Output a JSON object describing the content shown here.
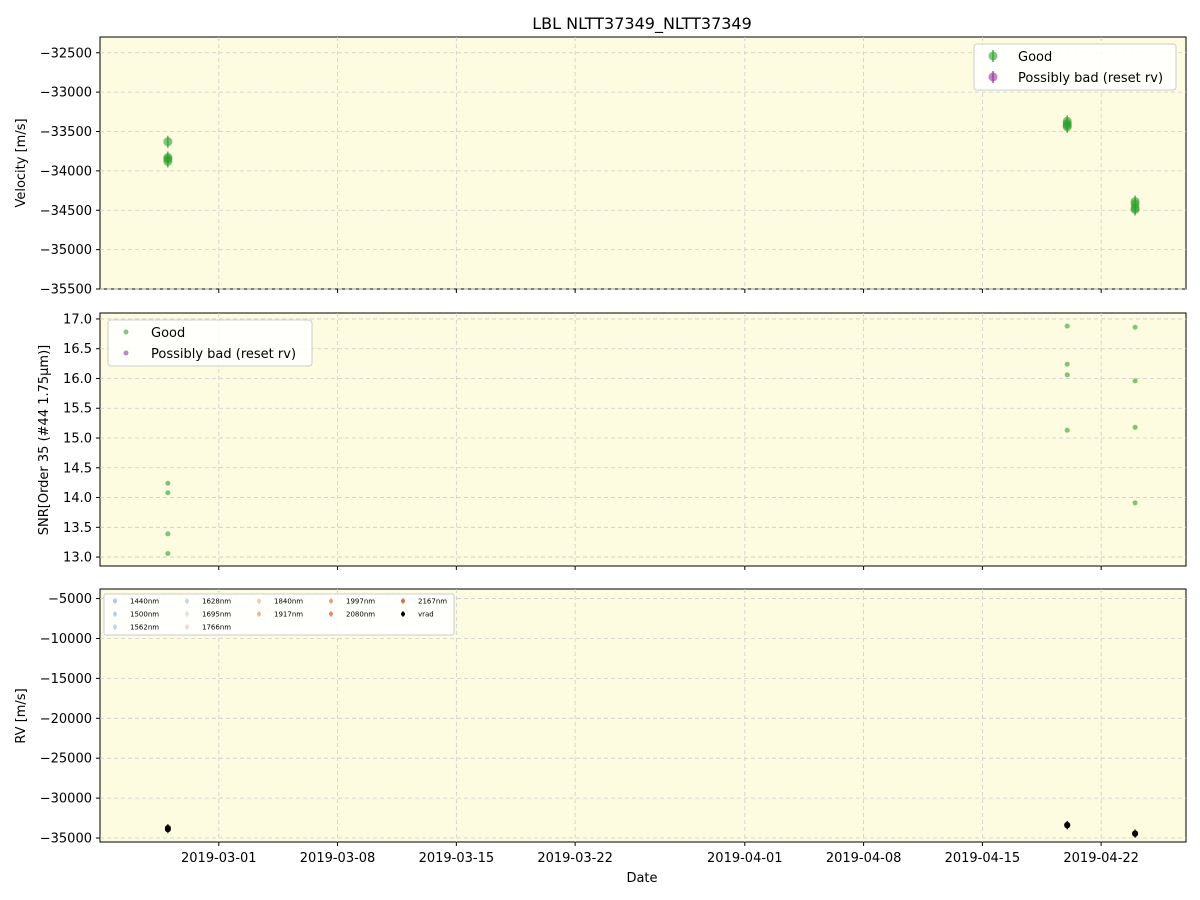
{
  "chart_data": [
    {
      "type": "scatter",
      "title": "LBL NLTT37349_NLTT37349",
      "xlabel": "",
      "ylabel": "Velocity [m/s]",
      "ylim": [
        -35500,
        -32300
      ],
      "yticks": [
        -32500,
        -33000,
        -33500,
        -34000,
        -34500,
        -35000,
        -35500
      ],
      "xlim": [
        "2019-02-22",
        "2019-04-27"
      ],
      "grid": true,
      "legend_position": "top-right",
      "legend": [
        "Good",
        "Possibly bad (reset rv)"
      ],
      "series": [
        {
          "name": "Good",
          "color": "#2ca02c",
          "points": [
            {
              "x": "2019-02-26",
              "y": -33630
            },
            {
              "x": "2019-02-26",
              "y": -33830
            },
            {
              "x": "2019-02-26",
              "y": -33880
            },
            {
              "x": "2019-02-26",
              "y": -33850
            },
            {
              "x": "2019-04-20",
              "y": -33370
            },
            {
              "x": "2019-04-20",
              "y": -33440
            },
            {
              "x": "2019-04-20",
              "y": -33420
            },
            {
              "x": "2019-04-20",
              "y": -33400
            },
            {
              "x": "2019-04-24",
              "y": -34390
            },
            {
              "x": "2019-04-24",
              "y": -34490
            },
            {
              "x": "2019-04-24",
              "y": -34470
            },
            {
              "x": "2019-04-24",
              "y": -34420
            }
          ]
        },
        {
          "name": "Possibly bad (reset rv)",
          "color": "#9b30a0",
          "points": []
        }
      ]
    },
    {
      "type": "scatter",
      "title": "",
      "xlabel": "",
      "ylabel": "SNR[Order 35 (#44 1.75μm)]",
      "ylim": [
        12.85,
        17.1
      ],
      "yticks": [
        17.0,
        16.5,
        16.0,
        15.5,
        15.0,
        14.5,
        14.0,
        13.5,
        13.0
      ],
      "ytick_labels": [
        "17.0",
        "16.5",
        "16.0",
        "15.5",
        "15.0",
        "14.5",
        "14.0",
        "13.5",
        "13.0"
      ],
      "grid": true,
      "legend_position": "top-left",
      "legend": [
        "Good",
        "Possibly bad (reset rv)"
      ],
      "series": [
        {
          "name": "Good",
          "color": "#2ca02c",
          "points": [
            {
              "x": "2019-02-26",
              "y": 14.24
            },
            {
              "x": "2019-02-26",
              "y": 14.08
            },
            {
              "x": "2019-02-26",
              "y": 13.39
            },
            {
              "x": "2019-02-26",
              "y": 13.06
            },
            {
              "x": "2019-04-20",
              "y": 16.88
            },
            {
              "x": "2019-04-20",
              "y": 16.24
            },
            {
              "x": "2019-04-20",
              "y": 16.06
            },
            {
              "x": "2019-04-20",
              "y": 15.13
            },
            {
              "x": "2019-04-24",
              "y": 16.86
            },
            {
              "x": "2019-04-24",
              "y": 15.96
            },
            {
              "x": "2019-04-24",
              "y": 15.18
            },
            {
              "x": "2019-04-24",
              "y": 13.91
            }
          ]
        },
        {
          "name": "Possibly bad (reset rv)",
          "color": "#9b30a0",
          "points": []
        }
      ]
    },
    {
      "type": "scatter",
      "title": "",
      "xlabel": "Date",
      "ylabel": "RV [m/s]",
      "ylim": [
        -35500,
        -3800
      ],
      "yticks": [
        -5000,
        -10000,
        -15000,
        -20000,
        -25000,
        -30000,
        -35000
      ],
      "grid": true,
      "legend_position": "top-left",
      "legend": [
        "1440nm",
        "1500nm",
        "1562nm",
        "1628nm",
        "1695nm",
        "1766nm",
        "1840nm",
        "1917nm",
        "1997nm",
        "2080nm",
        "2167nm",
        "vrad"
      ],
      "legend_colors": [
        "#a8c8ec",
        "#b4cfee",
        "#bcd7e8",
        "#c8d4ec",
        "#dde3ee",
        "#f0d8d2",
        "#f2c8b4",
        "#f0b496",
        "#ec9e80",
        "#e48a68",
        "#d8704e",
        "#000000"
      ],
      "series": [
        {
          "name": "vrad",
          "color": "#000000",
          "points": [
            {
              "x": "2019-02-26",
              "y": -33750
            },
            {
              "x": "2019-02-26",
              "y": -33900
            },
            {
              "x": "2019-04-20",
              "y": -33350
            },
            {
              "x": "2019-04-20",
              "y": -33420
            },
            {
              "x": "2019-04-24",
              "y": -34420
            },
            {
              "x": "2019-04-24",
              "y": -34480
            }
          ]
        }
      ]
    }
  ],
  "shared_x": {
    "xlim": [
      "2019-02-22",
      "2019-04-27"
    ],
    "ticks": [
      "2019-03-01",
      "2019-03-08",
      "2019-03-15",
      "2019-03-22",
      "2019-04-01",
      "2019-04-08",
      "2019-04-15",
      "2019-04-22"
    ],
    "label": "Date"
  },
  "colors": {
    "background": "#fdfbe0",
    "good": "#2ca02c",
    "bad": "#9b30a0",
    "grid": "#cccccc"
  }
}
